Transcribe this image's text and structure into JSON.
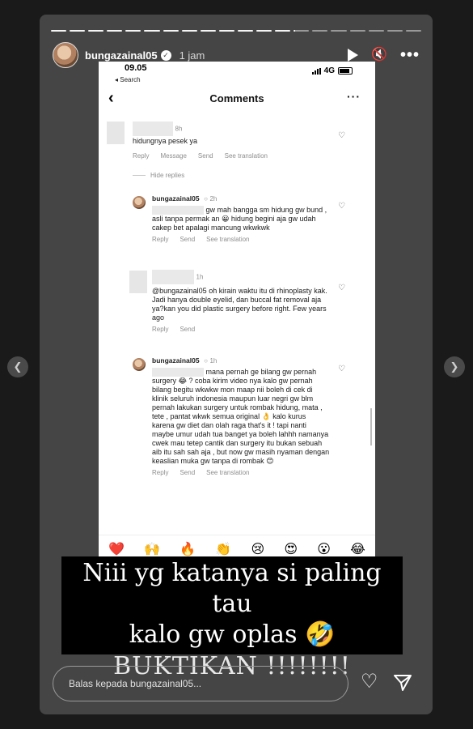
{
  "story": {
    "username": "bungazainal05",
    "time": "1 jam",
    "reply_placeholder": "Balas kepada bungazainal05..."
  },
  "screenshot": {
    "status_time": "09.05",
    "status_back": "◂ Search",
    "network": "4G",
    "title": "Comments",
    "hide_replies": "Hide replies",
    "comments": [
      {
        "time": "8h",
        "text": "hidungnya pesek ya",
        "actions": [
          "Reply",
          "Message",
          "Send",
          "See translation"
        ]
      },
      {
        "username": "bungazainal05",
        "time": "2h",
        "text": "gw mah bangga sm hidung gw bund , asli tanpa permak an 😀 hidung begini aja gw udah cakep bet apalagi mancung wkwkwk",
        "actions": [
          "Reply",
          "Send",
          "See translation"
        ]
      },
      {
        "time": "1h",
        "text": "@bungazainal05 oh kirain waktu itu di rhinoplasty kak. Jadi hanya double eyelid, dan buccal fat removal aja ya?kan you did plastic surgery before right. Few years ago",
        "actions": [
          "Reply",
          "Send"
        ]
      },
      {
        "username": "bungazainal05",
        "time": "1h",
        "text": "mana pernah ge bilang gw pernah surgery 😂 ? coba kirim video nya kalo gw pernah bilang begitu wkwkw mon maap nii boleh di cek di klinik seluruh indonesia maupun luar negri gw blm pernah lakukan surgery untuk rombak hidung, mata , tete , pantat wkwk semua original 👌 kalo kurus karena gw diet dan olah raga that's it ! tapi nanti maybe umur udah tua banget ya boleh lahhh namanya cwek mau tetep cantik dan surgery itu bukan sebuah aib itu sah sah aja , but now gw masih nyaman dengan keaslian muka gw tanpa di rombak 😊",
        "actions": [
          "Reply",
          "Send",
          "See translation"
        ]
      }
    ],
    "emojis": [
      "❤️",
      "🙌",
      "🔥",
      "👏",
      "😢",
      "😍",
      "😮",
      "😂"
    ]
  },
  "caption": {
    "line1": "Niii yg katanya si paling tau",
    "line2": "kalo gw oplas 🤣",
    "line3": "BUKTIKAN !!!!!!!!"
  },
  "icons": {
    "verified": "verified-badge-icon",
    "play": "play-icon",
    "mute": "mute-icon",
    "more": "more-icon",
    "heart": "heart-icon",
    "send": "send-icon"
  }
}
